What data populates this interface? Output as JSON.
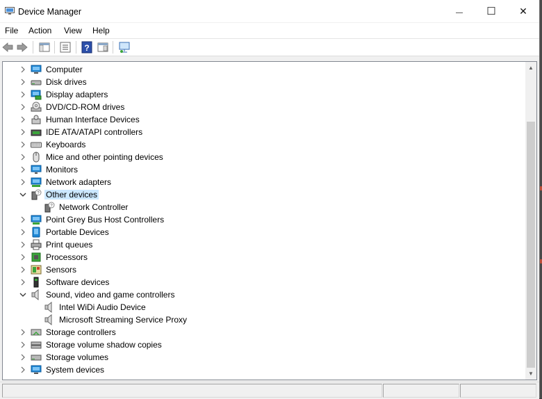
{
  "window": {
    "title": "Device Manager",
    "minimize_glyph": "—",
    "maximize_glyph": "☐",
    "close_glyph": "✕"
  },
  "menu": [
    "File",
    "Action",
    "View",
    "Help"
  ],
  "toolbar": {
    "buttons": [
      "back-icon",
      "forward-icon",
      "show-hide-tree-icon",
      "properties-icon",
      "help-icon",
      "update-driver-icon",
      "scan-hardware-icon"
    ]
  },
  "tree": {
    "items": [
      {
        "label": "Computer",
        "expanded": false,
        "icon": "computer-icon"
      },
      {
        "label": "Disk drives",
        "expanded": false,
        "icon": "disk-drive-icon"
      },
      {
        "label": "Display adapters",
        "expanded": false,
        "icon": "display-adapter-icon"
      },
      {
        "label": "DVD/CD-ROM drives",
        "expanded": false,
        "icon": "dvd-drive-icon"
      },
      {
        "label": "Human Interface Devices",
        "expanded": false,
        "icon": "hid-icon"
      },
      {
        "label": "IDE ATA/ATAPI controllers",
        "expanded": false,
        "icon": "ide-controller-icon"
      },
      {
        "label": "Keyboards",
        "expanded": false,
        "icon": "keyboard-icon"
      },
      {
        "label": "Mice and other pointing devices",
        "expanded": false,
        "icon": "mouse-icon"
      },
      {
        "label": "Monitors",
        "expanded": false,
        "icon": "monitor-icon"
      },
      {
        "label": "Network adapters",
        "expanded": false,
        "icon": "network-adapter-icon"
      },
      {
        "label": "Other devices",
        "expanded": true,
        "selected": true,
        "icon": "unknown-device-icon",
        "children": [
          {
            "label": "Network Controller",
            "icon": "unknown-device-icon"
          }
        ]
      },
      {
        "label": "Point Grey Bus Host Controllers",
        "expanded": false,
        "icon": "bus-controller-icon"
      },
      {
        "label": "Portable Devices",
        "expanded": false,
        "icon": "portable-device-icon"
      },
      {
        "label": "Print queues",
        "expanded": false,
        "icon": "printer-icon"
      },
      {
        "label": "Processors",
        "expanded": false,
        "icon": "processor-icon"
      },
      {
        "label": "Sensors",
        "expanded": false,
        "icon": "sensor-icon"
      },
      {
        "label": "Software devices",
        "expanded": false,
        "icon": "software-device-icon"
      },
      {
        "label": "Sound, video and game controllers",
        "expanded": true,
        "icon": "speaker-icon",
        "children": [
          {
            "label": "Intel WiDi Audio Device",
            "icon": "speaker-icon"
          },
          {
            "label": "Microsoft Streaming Service Proxy",
            "icon": "speaker-icon"
          }
        ]
      },
      {
        "label": "Storage controllers",
        "expanded": false,
        "icon": "storage-controller-icon"
      },
      {
        "label": "Storage volume shadow copies",
        "expanded": false,
        "icon": "shadow-copy-icon"
      },
      {
        "label": "Storage volumes",
        "expanded": false,
        "icon": "storage-volume-icon"
      },
      {
        "label": "System devices",
        "expanded": false,
        "icon": "system-device-icon"
      }
    ]
  },
  "colors": {
    "selection": "#cce8ff",
    "monitor_blue": "#1e88d6",
    "accent_green": "#3aa53a"
  }
}
